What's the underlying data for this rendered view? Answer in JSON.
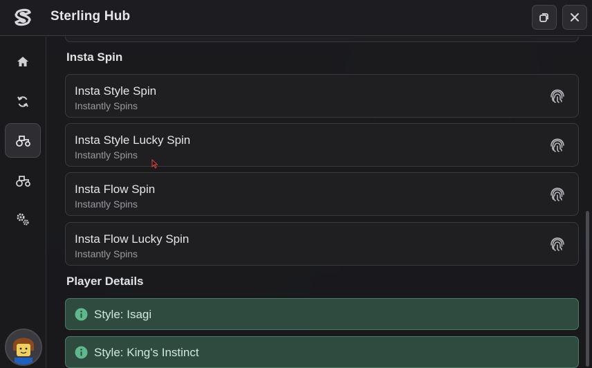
{
  "window": {
    "title": "Sterling Hub"
  },
  "titlebar": {
    "restore_icon": "restore-window-icon",
    "close_icon": "close-icon"
  },
  "sidebar": {
    "items": [
      {
        "icon": "home-icon",
        "active": false
      },
      {
        "icon": "refresh-icon",
        "active": false
      },
      {
        "icon": "tractor-icon",
        "active": true
      },
      {
        "icon": "tractor-icon",
        "active": false
      },
      {
        "icon": "gears-icon",
        "active": false
      }
    ]
  },
  "sections": {
    "insta_spin": {
      "title": "Insta Spin",
      "buttons": [
        {
          "title": "Insta Style Spin",
          "description": "Instantly Spins",
          "icon": "fingerprint-icon"
        },
        {
          "title": "Insta Style Lucky Spin",
          "description": "Instantly Spins",
          "icon": "fingerprint-icon"
        },
        {
          "title": "Insta Flow Spin",
          "description": "Instantly Spins",
          "icon": "fingerprint-icon"
        },
        {
          "title": "Insta Flow Lucky Spin",
          "description": "Instantly Spins",
          "icon": "fingerprint-icon"
        }
      ]
    },
    "player_details": {
      "title": "Player Details",
      "paragraphs": [
        {
          "text": "Style: Isagi",
          "icon": "info-icon"
        },
        {
          "text": "Style: King's Instinct",
          "icon": "info-icon"
        }
      ]
    }
  },
  "colors": {
    "accent_green": "#4f7a66",
    "paragraph_bg": "#2f4a3f",
    "card_bg": "#1f1f22"
  }
}
